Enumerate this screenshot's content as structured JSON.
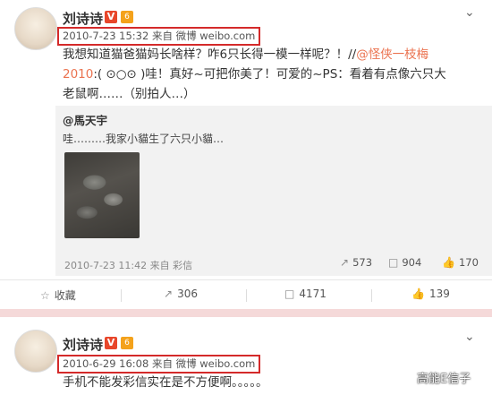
{
  "posts": [
    {
      "author": "刘诗诗",
      "badge_v": "V",
      "level": "6",
      "meta": "2010-7-23 15:32 来自 微博 weibo.com",
      "text_before": "我想知道猫爸猫妈长啥样？咋6只长得一模一样呢？！//",
      "mention": "@怪侠一枝梅2010",
      "text_after": ":( ⊙○⊙ )哇！真好~可把你美了！可爱的~PS：看着有点像六只大老鼠啊……（别拍人…）",
      "repost": {
        "author": "@馬天宇",
        "text": "哇………我家小貓生了六只小貓…",
        "meta": "2010-7-23 11:42 来自 彩信",
        "forwards": "573",
        "comments": "904",
        "likes": "170"
      },
      "actions": {
        "favorite_label": "收藏",
        "forward_count": "306",
        "comment_count": "4171",
        "like_count": "139"
      }
    },
    {
      "author": "刘诗诗",
      "badge_v": "V",
      "level": "6",
      "meta": "2010-6-29 16:08 来自 微博 weibo.com",
      "text": "手机不能发彩信实在是不方便啊。。。。。"
    }
  ],
  "watermark": "高能E信子",
  "icons": {
    "chevron": "chevron-down-icon",
    "forward": "forward-icon",
    "comment": "comment-icon",
    "like": "like-icon",
    "favorite": "star-icon"
  },
  "colors": {
    "highlight_box": "#d42a2a",
    "mention": "#eb7350",
    "v_badge": "#e8462a"
  }
}
